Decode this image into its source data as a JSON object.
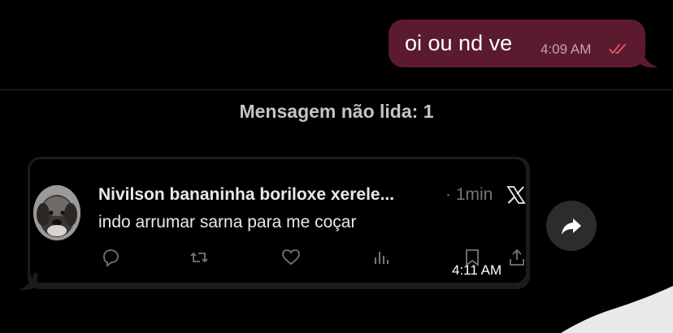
{
  "sent_message": {
    "text": "oi ou nd ve",
    "time": "4:09 AM",
    "status_icon": "double-check-icon",
    "bubble_color": "#5b1a2e"
  },
  "unread_divider": {
    "label": "Mensagem não lida: 1"
  },
  "received_message": {
    "tweet": {
      "author": "Nivilson bananinha boriloxe xerele...",
      "time": "· 1min",
      "text": "indo arrumar sarna para me coçar",
      "platform_icon": "x-logo-icon",
      "actions": [
        "reply-icon",
        "retweet-icon",
        "like-icon",
        "views-icon",
        "bookmark-icon",
        "share-icon"
      ]
    },
    "time": "4:11 AM",
    "bubble_color": "#1b1b1d"
  },
  "forward_button": {
    "icon": "forward-arrow-icon"
  }
}
